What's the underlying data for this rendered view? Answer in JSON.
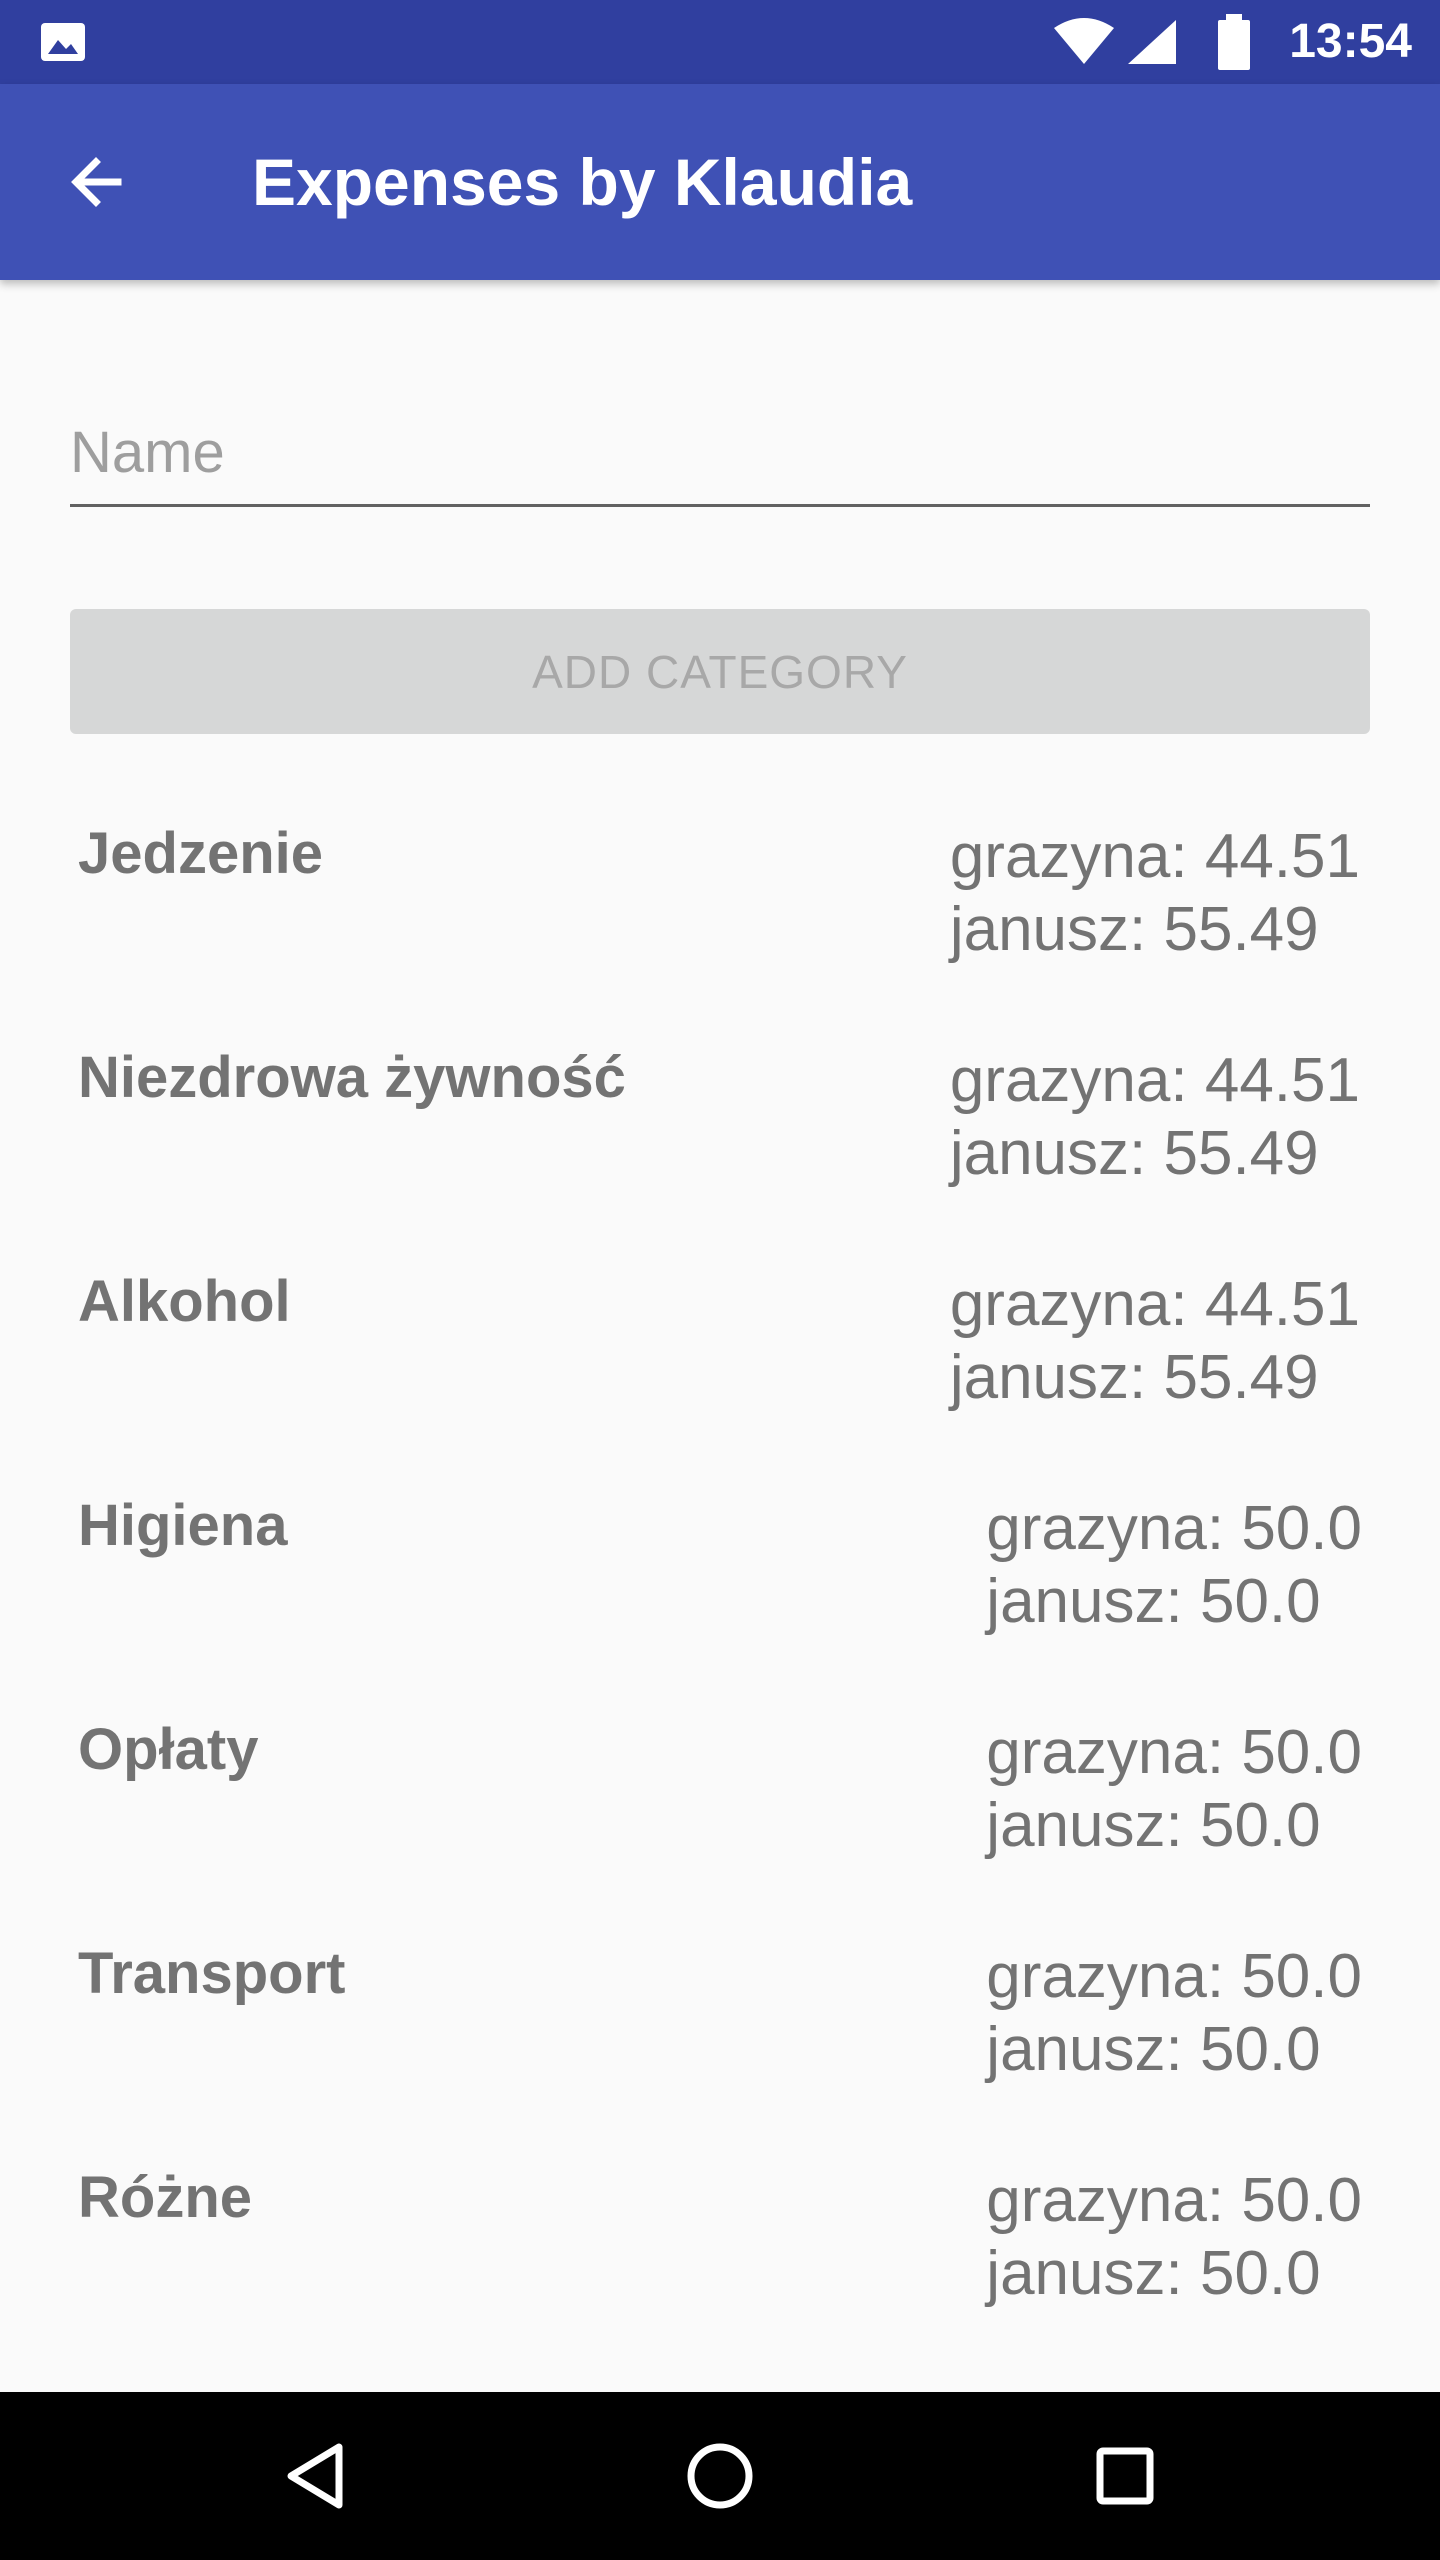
{
  "status_bar": {
    "time": "13:54",
    "icons": [
      "gallery-icon",
      "wifi-icon",
      "signal-icon",
      "battery-icon"
    ]
  },
  "app_bar": {
    "title": "Expenses by Klaudia",
    "back_icon": "arrow-back-icon"
  },
  "form": {
    "name_placeholder": "Name",
    "name_value": "",
    "add_button_label": "ADD CATEGORY"
  },
  "categories": [
    {
      "name": "Jedzenie",
      "line1": "grazyna: 44.51",
      "line2": "janusz: 55.49"
    },
    {
      "name": "Niezdrowa żywność",
      "line1": "grazyna: 44.51",
      "line2": "janusz: 55.49"
    },
    {
      "name": "Alkohol",
      "line1": "grazyna: 44.51",
      "line2": "janusz: 55.49"
    },
    {
      "name": "Higiena",
      "line1": "grazyna: 50.0",
      "line2": "janusz: 50.0"
    },
    {
      "name": "Opłaty",
      "line1": "grazyna: 50.0",
      "line2": "janusz: 50.0"
    },
    {
      "name": "Transport",
      "line1": "grazyna: 50.0",
      "line2": "janusz: 50.0"
    },
    {
      "name": "Różne",
      "line1": "grazyna: 50.0",
      "line2": "janusz: 50.0"
    }
  ],
  "nav_bar": {
    "icons": [
      "back-triangle-icon",
      "home-circle-icon",
      "recents-square-icon"
    ]
  },
  "colors": {
    "status_bar": "#303f9f",
    "app_bar": "#3f51b5",
    "background": "#fafafa",
    "button_bg": "#d6d7d7",
    "text_gray": "#737373"
  }
}
